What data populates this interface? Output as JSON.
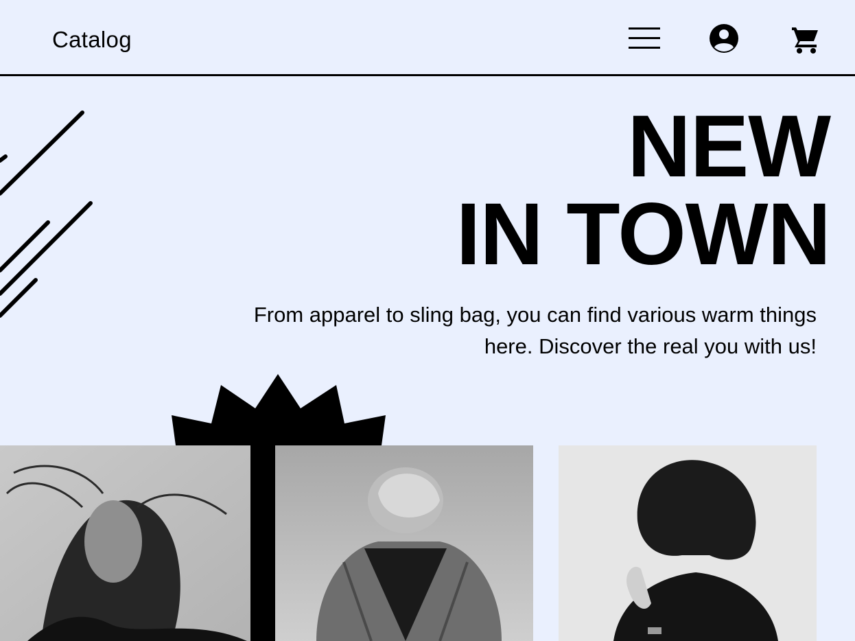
{
  "header": {
    "brand": "Catalog",
    "icons": [
      "menu-icon",
      "account-icon",
      "cart-icon"
    ]
  },
  "hero": {
    "headline_line1": "NEW",
    "headline_line2": "IN TOWN",
    "tagline": "From apparel to sling bag, you can find various warm things here. Discover the real you with us!"
  },
  "colors": {
    "background": "#eaf0fe",
    "ink": "#000000"
  }
}
